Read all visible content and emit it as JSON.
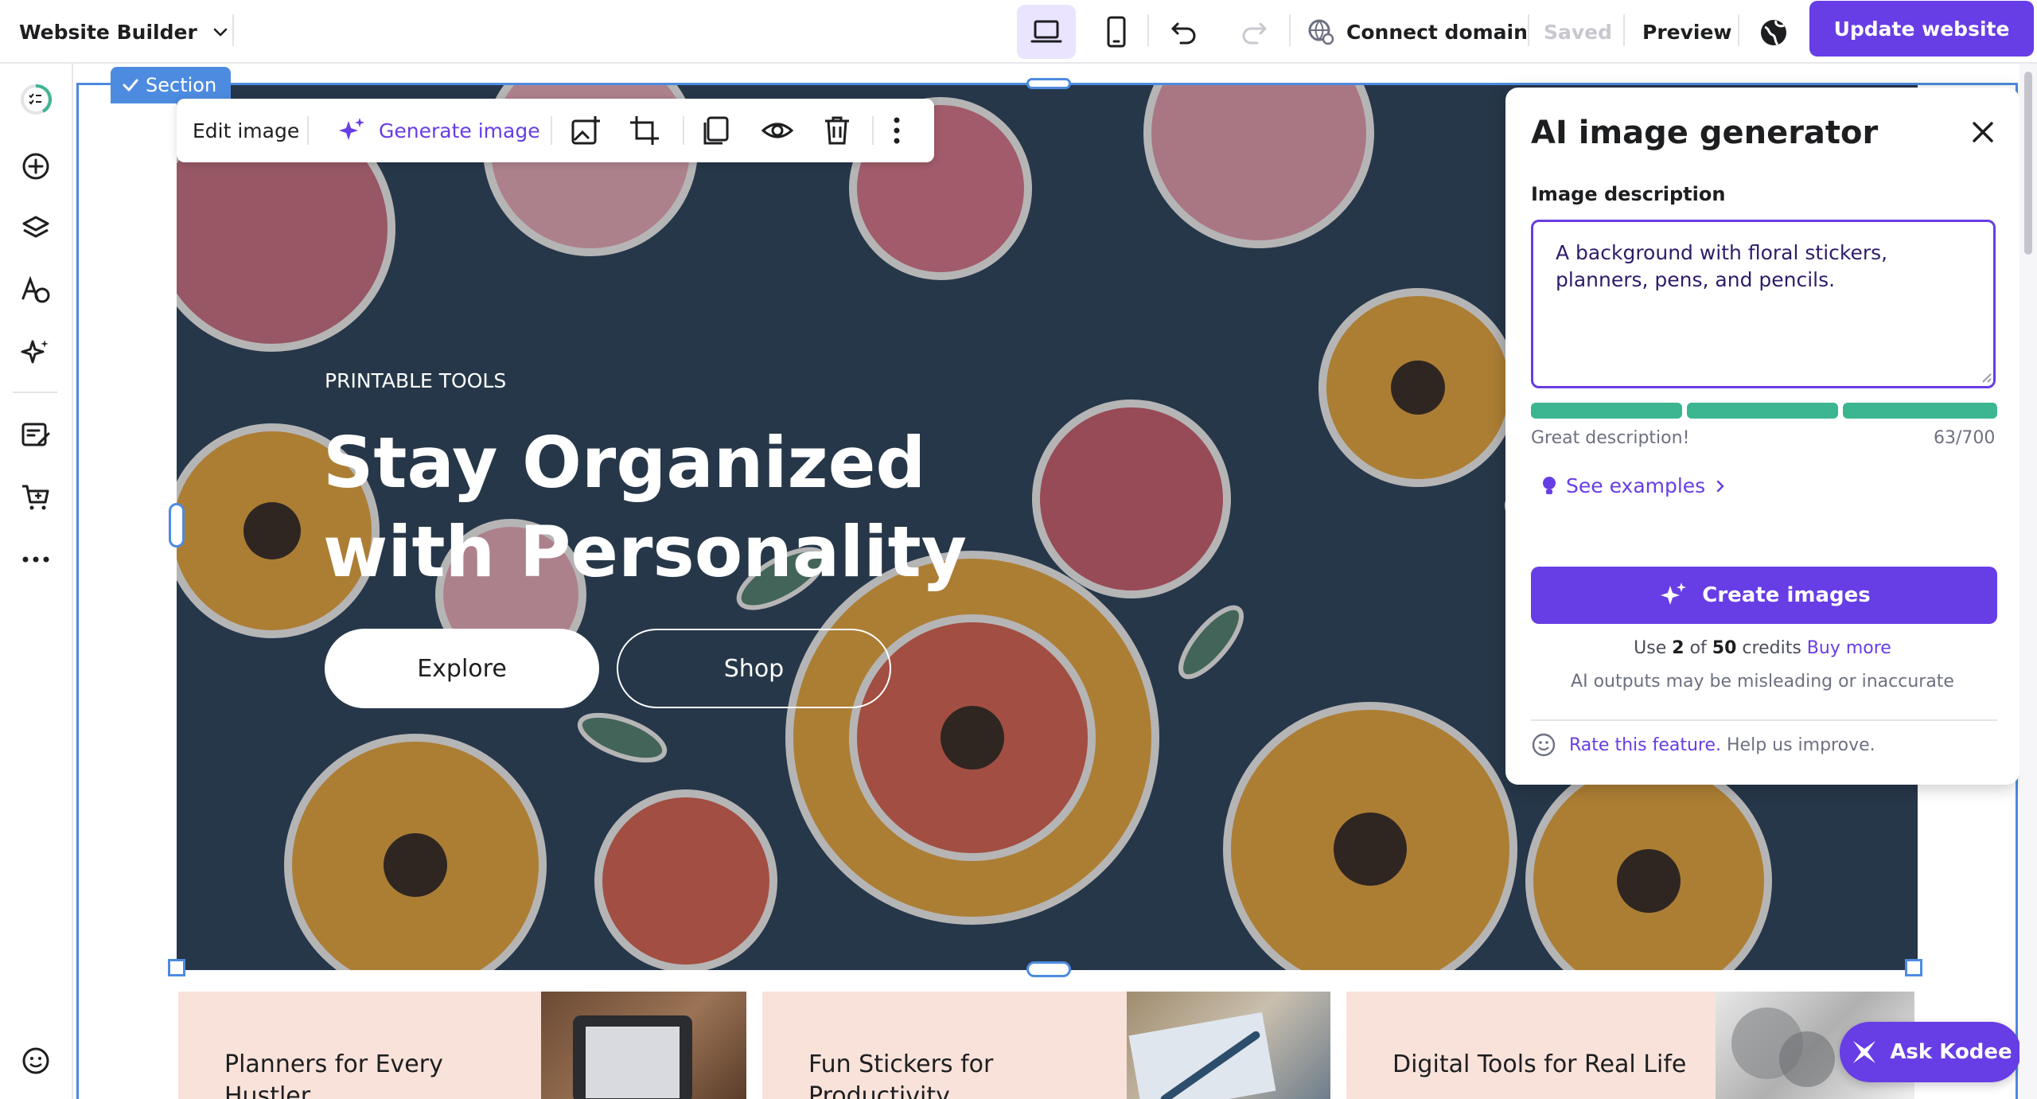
{
  "topbar": {
    "app_name": "Website Builder",
    "connect_domain": "Connect domain",
    "saved": "Saved",
    "preview": "Preview",
    "update_website": "Update website"
  },
  "section_tag": "Section",
  "edit_toolbar": {
    "edit_image": "Edit image",
    "generate_image": "Generate image"
  },
  "hero": {
    "eyebrow": "PRINTABLE TOOLS",
    "headline_line1": "Stay Organized",
    "headline_line2": "with Personality",
    "explore": "Explore",
    "shop": "Shop"
  },
  "ai_panel": {
    "title": "AI image generator",
    "description_label": "Image description",
    "description_value": "A background with floral stickers, planners, pens, and pencils.",
    "quality_text": "Great description!",
    "char_count": "63/700",
    "see_examples": "See examples",
    "create_images": "Create images",
    "credits_use": "Use",
    "credits_used": "2",
    "credits_of": "of",
    "credits_total": "50",
    "credits_label": "credits",
    "buy_more": "Buy more",
    "disclaimer": "AI outputs may be misleading or inaccurate",
    "rate_feature": "Rate this feature.",
    "help_improve": "Help us improve.",
    "quality_level": 1.0
  },
  "cards": [
    {
      "title": "Planners for Every Hustler"
    },
    {
      "title": "Fun Stickers for Productivity"
    },
    {
      "title": "Digital Tools for Real Life"
    }
  ],
  "ask_kodee": "Ask Kodee",
  "colors": {
    "accent": "#673de6",
    "selection": "#4d8be0",
    "meter": "#3cb591",
    "card_bg": "#f8e2da"
  }
}
